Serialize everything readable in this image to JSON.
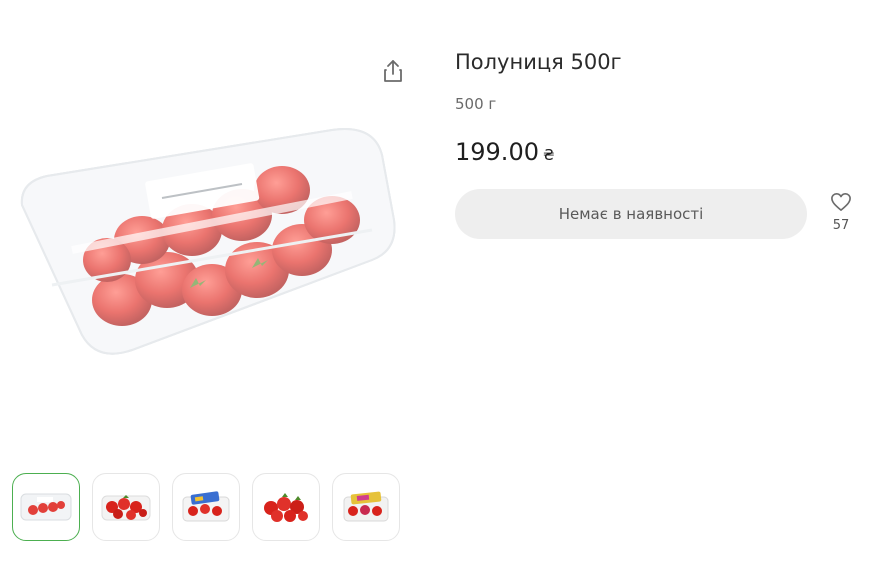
{
  "product": {
    "title": "Полуниця 500г",
    "weight": "500 г",
    "price": "199.00",
    "currency": "₴",
    "availability_label": "Немає в наявності",
    "favorites_count": "57"
  },
  "icons": {
    "share": "share-icon",
    "favorite": "heart-icon"
  },
  "gallery": {
    "thumbnail_count": 5,
    "active_index": 0
  },
  "colors": {
    "active_border": "#4caf50",
    "button_bg": "#eeeeee"
  }
}
